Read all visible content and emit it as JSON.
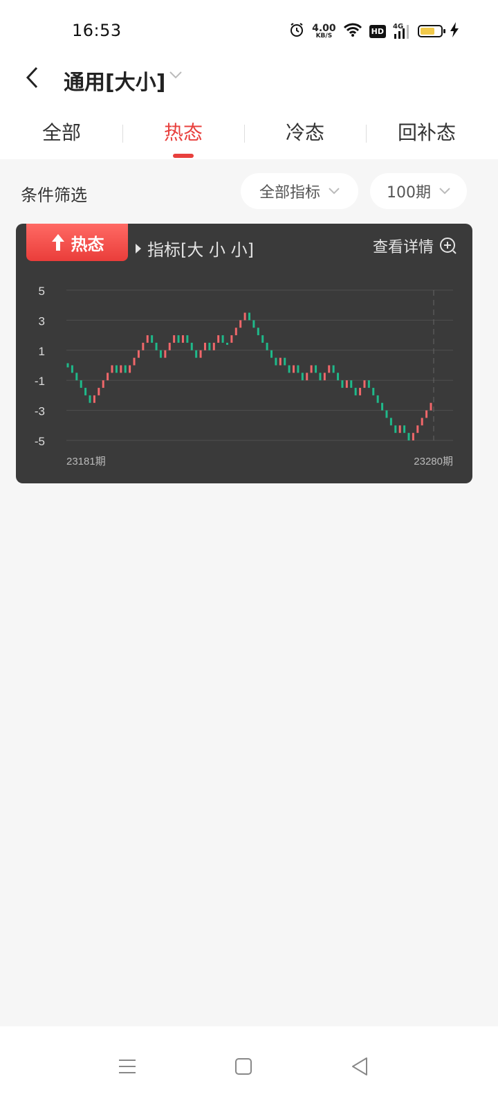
{
  "status_bar": {
    "time": "16:53",
    "net_speed_value": "4.00",
    "net_speed_unit": "KB/S",
    "hd": "HD",
    "network": "4G",
    "battery_level": 0.7,
    "icons": [
      "alarm-icon",
      "wifi-icon",
      "hd-icon",
      "signal-4g-icon",
      "battery-icon",
      "charging-icon"
    ]
  },
  "header": {
    "title": "通用[大小]"
  },
  "tabs": [
    {
      "label": "全部",
      "active": false
    },
    {
      "label": "热态",
      "active": true
    },
    {
      "label": "冷态",
      "active": false
    },
    {
      "label": "回补态",
      "active": false
    }
  ],
  "filter": {
    "label": "条件筛选",
    "indicator_select": "全部指标",
    "period_select": "100期"
  },
  "card": {
    "badge": "热态",
    "indicator": "指标[大 小 小]",
    "detail": "查看详情"
  },
  "colors": {
    "accent": "#e8403d",
    "up": "#f0676a",
    "down": "#1fb98a",
    "card_bg": "#3a3a3a"
  },
  "chart_data": {
    "type": "candlestick",
    "title": "",
    "xlabel": "",
    "ylabel": "",
    "x_start_label": "23181期",
    "x_end_label": "23280期",
    "yticks": [
      5,
      3,
      1,
      -1,
      -3,
      -5
    ],
    "ylim": [
      -5,
      5
    ],
    "grid": true,
    "values": [
      0,
      -0.5,
      -1,
      -1.5,
      -2,
      -2.5,
      -2,
      -1.5,
      -1,
      -0.5,
      0,
      -0.5,
      0,
      -0.5,
      0,
      0.5,
      1,
      1.5,
      2,
      1.5,
      1,
      0.5,
      1,
      1.5,
      2,
      1.5,
      2,
      1.5,
      1,
      0.5,
      1,
      1.5,
      1,
      1.5,
      2,
      1.5,
      1.5,
      2,
      2.5,
      3,
      3.5,
      3,
      2.5,
      2,
      1.5,
      1,
      0.5,
      0,
      0.5,
      0,
      -0.5,
      0,
      -0.5,
      -1,
      -0.5,
      0,
      -0.5,
      -1,
      -0.5,
      0,
      -0.5,
      -1,
      -1.5,
      -1,
      -1.5,
      -2,
      -1.5,
      -1,
      -1.5,
      -2,
      -2.5,
      -3,
      -3.5,
      -4,
      -4.5,
      -4,
      -4.5,
      -5,
      -4.5,
      -4,
      -3.5,
      -3,
      -2.5
    ]
  },
  "nav_bar": {
    "buttons": [
      "menu-icon",
      "home-icon",
      "back-triangle-icon"
    ]
  }
}
